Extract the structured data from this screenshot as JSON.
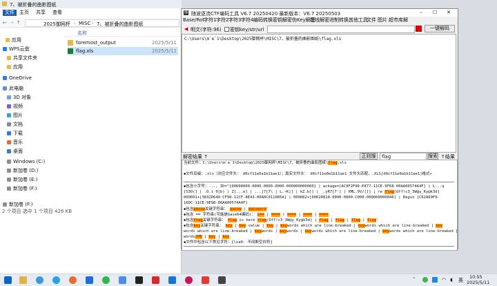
{
  "explorer": {
    "tab_title": "7、被折叠的曲影图纸",
    "menu": [
      "文件",
      "主页",
      "共享",
      "查看"
    ],
    "breadcrumb": [
      "2025御网杯",
      "MISC",
      "7、被折叠的曲影图纸"
    ],
    "nav": [
      {
        "label": "应用",
        "icon": "folder-icon"
      },
      {
        "label": "WPS云盘",
        "icon": "cloud-icon"
      },
      {
        "label": "共享文件夹",
        "icon": "folder-icon"
      },
      {
        "label": "应用",
        "icon": "folder-icon"
      },
      {
        "label": "OneDrive",
        "icon": "cloud-icon"
      },
      {
        "label": "此电脑",
        "icon": "computer-icon"
      },
      {
        "label": "3D 对象",
        "icon": "cube-icon"
      },
      {
        "label": "视频",
        "icon": "video-icon"
      },
      {
        "label": "图片",
        "icon": "picture-icon"
      },
      {
        "label": "文档",
        "icon": "document-icon"
      },
      {
        "label": "下载",
        "icon": "download-icon"
      },
      {
        "label": "音乐",
        "icon": "music-icon"
      },
      {
        "label": "桌面",
        "icon": "desktop-icon"
      },
      {
        "label": "Windows (C:)",
        "icon": "drive-icon"
      },
      {
        "label": "新加卷 (D:)",
        "icon": "drive-icon"
      },
      {
        "label": "新加卷 (E:)",
        "icon": "drive-icon"
      },
      {
        "label": "新加卷 (F:)",
        "icon": "drive-icon"
      },
      {
        "label": "新加卷 (F:)",
        "icon": "drive-icon"
      }
    ],
    "col_name": "名称",
    "files": [
      {
        "name": "foremost_output",
        "date": "2025/5/11",
        "icon": "folder-icon"
      },
      {
        "name": "flag.xls",
        "date": "2025/5/11",
        "icon": "xls-icon"
      }
    ],
    "status": "2 个项目  选中 1 个项目  426 KB"
  },
  "tool": {
    "title": "随波逐流CTF编码工具 V6.7  20250420    最新版本：V6.7  20250503",
    "menu": [
      "Base/Rot",
      "字符1",
      "字符2",
      "字符3",
      "字符4",
      "编码转换",
      "密钥解密",
      "伪Key解密",
      "在线解密",
      "进制转换",
      "其他工具",
      "文件",
      "图片",
      "超市库解"
    ],
    "toolbar_text": "明文(字符:96)",
    "toolbar_key": "密钥key/str/url",
    "decode_button": "一键解码",
    "input_text": "C:\\Users\\m`e`1\\Desktop\\2025御网杯\\MISC\\7、被折叠的曲影图纸\\flag.xls",
    "mid_label": "解密结果 ↑",
    "regex_label": "正则搜",
    "search_value": "flag",
    "search_button": "搜索",
    "result_label": "↑结果 ↓",
    "output_lines": [
      [
        {
          "t": "当前文件：C:\\Users\\m`e`1\\Desktop\\2025御网杯\\MISC\\7、被折叠的曲影图纸\\"
        },
        {
          "t": "flag",
          "h": 1
        },
        {
          "t": ".xls"
        }
      ],
      [
        {
          "t": ""
        }
      ],
      [
        {
          "t": "◆文件后缀：.xls（对应文件头： d0cf11e0a1b11ae1）；真实文件头： d0cf11e0a1b11ae1 文件头匹配，.XLS[d0cf11e0a1b11ae1]格式•"
        }
      ],
      [
        {
          "t": ""
        }
      ],
      [
        {
          "t": "◆包含小字号：..., ID=\"{00000000-0000-0000-0000-000000000000} | ackage=[AC9F2F90-E877-11CE-9F68-00AA00574A4F] | L...q"
        }
      ],
      [
        {
          "t": "[S3O(] | .O.i 0[b) | Z[...e] | ...]7[7\\ | L.~K|] | kZ.b[] | _.yR7[7'] | XML.9V/[]] | re "
        },
        {
          "t": "flag",
          "h": 1
        },
        {
          "t": "(Off!c3_3W@y_Ky@k3d]"
        }
      ],
      [
        {
          "t": " 000001+[3832D640-CF90-11CF-8E43-00A0C911005A] | 000002+[00020810-0000-0000-C000-000000000046] | Begin [C62A69F0-"
        }
      ],
      [
        {
          "t": "16DC-11CE-9E98-00AA00574A4F]"
        }
      ],
      [
        {
          "t": "◆包含"
        },
        {
          "t": "passw",
          "h": 1
        },
        {
          "t": "关键字符串： "
        },
        {
          "t": "passw",
          "h": 1
        },
        {
          "t": " | "
        },
        {
          "t": "password",
          "h": 1
        },
        {
          "t": "'"
        }
      ],
      [
        {
          "t": "◆包含 == 字符串(可能是base64编码)： "
        },
        {
          "t": "L==",
          "h": 1
        },
        {
          "t": " | "
        },
        {
          "t": "====",
          "h": 1
        },
        {
          "t": " | "
        },
        {
          "t": "====",
          "h": 1
        },
        {
          "t": " | "
        },
        {
          "t": "====",
          "h": 1
        },
        {
          "t": " | "
        },
        {
          "t": "====",
          "h": 1
        }
      ],
      [
        {
          "t": "◆包含"
        },
        {
          "t": "flag",
          "h": 1
        },
        {
          "t": "关键字符串： "
        },
        {
          "t": "flag",
          "h": 1
        },
        {
          "t": " is here "
        },
        {
          "t": "flag",
          "h": 1
        },
        {
          "t": "(Off!c3_3W@y_Ky@k3d] | "
        },
        {
          "t": "flag",
          "h": 1
        },
        {
          "t": " | "
        },
        {
          "t": "flag",
          "h": 1
        },
        {
          "t": " | "
        },
        {
          "t": "flag",
          "h": 1
        },
        {
          "t": " | "
        },
        {
          "t": "flag",
          "h": 1
        },
        {
          "t": "'"
        }
      ],
      [
        {
          "t": "◆包含"
        },
        {
          "t": "key",
          "h": 1
        },
        {
          "t": "关键字符串： "
        },
        {
          "t": "key",
          "h": 1
        },
        {
          "t": " | "
        },
        {
          "t": "key",
          "h": 1
        },
        {
          "t": " value | "
        },
        {
          "t": "key",
          "h": 1
        },
        {
          "t": " | "
        },
        {
          "t": "key",
          "h": 1
        },
        {
          "t": "words which are line-breaked | "
        },
        {
          "t": "key",
          "h": 1
        },
        {
          "t": "words which are line-breaked | "
        },
        {
          "t": "key",
          "h": 1
        }
      ],
      [
        {
          "t": "words which are line-breaked | "
        },
        {
          "t": "key",
          "h": 1
        },
        {
          "t": "words | "
        },
        {
          "t": "key",
          "h": 1
        },
        {
          "t": "words | "
        },
        {
          "t": "key",
          "h": 1
        },
        {
          "t": "words which are line-breaked | "
        },
        {
          "t": "key",
          "h": 1
        },
        {
          "t": "words which are line-breaked | "
        },
        {
          "t": "key",
          "h": 1
        }
      ],
      [
        {
          "t": "words"
        },
        {
          "t": "/PB",
          "h": 1
        },
        {
          "t": " | "
        },
        {
          "t": "key",
          "h": 1
        },
        {
          "t": " | "
        },
        {
          "t": "key",
          "h": 1
        }
      ],
      [
        {
          "t": "◆文件中包含以下常见字符：[\\xa0: 不间断空白符]"
        }
      ],
      [
        {
          "t": ""
        }
      ],
      [
        {
          "t": "◆Binwalk文件包含检测："
        }
      ],
      [
        {
          "t": ""
        }
      ],
      [
        {
          "t": "1:Copyright string  \"Copyright-Meldung darf nicht entfernt oder ver-\""
        }
      ],
      [
        {
          "t": "2:GIF image data, version \"89a\", 700 x 525"
        }
      ],
      [
        {
          "t": "3:PC bitmap, Windows 3.x format,, 1 x 1 x 24"
        }
      ]
    ]
  },
  "taskbar": {
    "time": "10:55",
    "date": "2025/5/11",
    "lang": "英"
  }
}
